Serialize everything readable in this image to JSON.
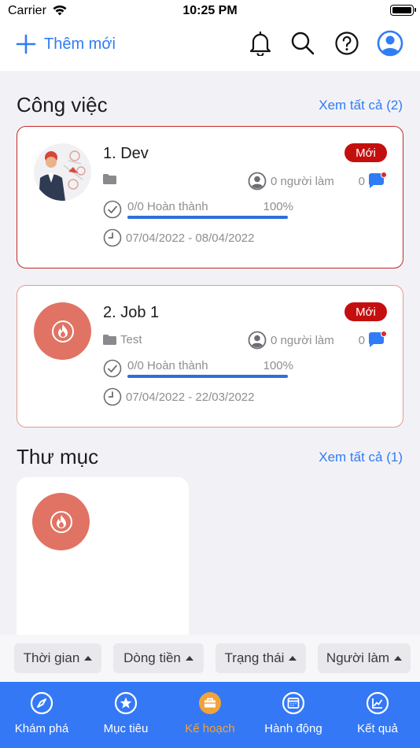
{
  "status": {
    "carrier": "Carrier",
    "time": "10:25 PM"
  },
  "topbar": {
    "add_label": "Thêm mới"
  },
  "jobs_section": {
    "title": "Công việc",
    "see_all": "Xem tất cả (2)"
  },
  "jobs": [
    {
      "title": "1. Dev",
      "badge": "Mới",
      "folder": "",
      "workers": "0 người làm",
      "comments": "0",
      "progress_label": "0/0 Hoàn thành",
      "progress_pct": "100%",
      "progress_value": 1.0,
      "dates": "07/04/2022 - 08/04/2022"
    },
    {
      "title": "2. Job 1",
      "badge": "Mới",
      "folder": "Test",
      "workers": "0 người làm",
      "comments": "0",
      "progress_label": "0/0 Hoàn thành",
      "progress_pct": "100%",
      "progress_value": 1.0,
      "dates": "07/04/2022 - 22/03/2022"
    }
  ],
  "folders_section": {
    "title": "Thư mục",
    "see_all": "Xem tất cả (1)"
  },
  "filters": [
    "Thời gian",
    "Dòng tiền",
    "Trạng thái",
    "Người làm"
  ],
  "tabs": [
    {
      "label": "Khám phá",
      "icon": "compass-icon"
    },
    {
      "label": "Mục tiêu",
      "icon": "star-icon"
    },
    {
      "label": "Kế hoạch",
      "icon": "briefcase-icon",
      "active": true
    },
    {
      "label": "Hành động",
      "icon": "calendar-icon"
    },
    {
      "label": "Kết quả",
      "icon": "chart-icon"
    }
  ],
  "colors": {
    "accent": "#2f7cf6",
    "tab_bar": "#3478f6",
    "badge": "#c40f0f",
    "fire_avatar": "#e17364",
    "active_tab": "#f1a33a"
  }
}
